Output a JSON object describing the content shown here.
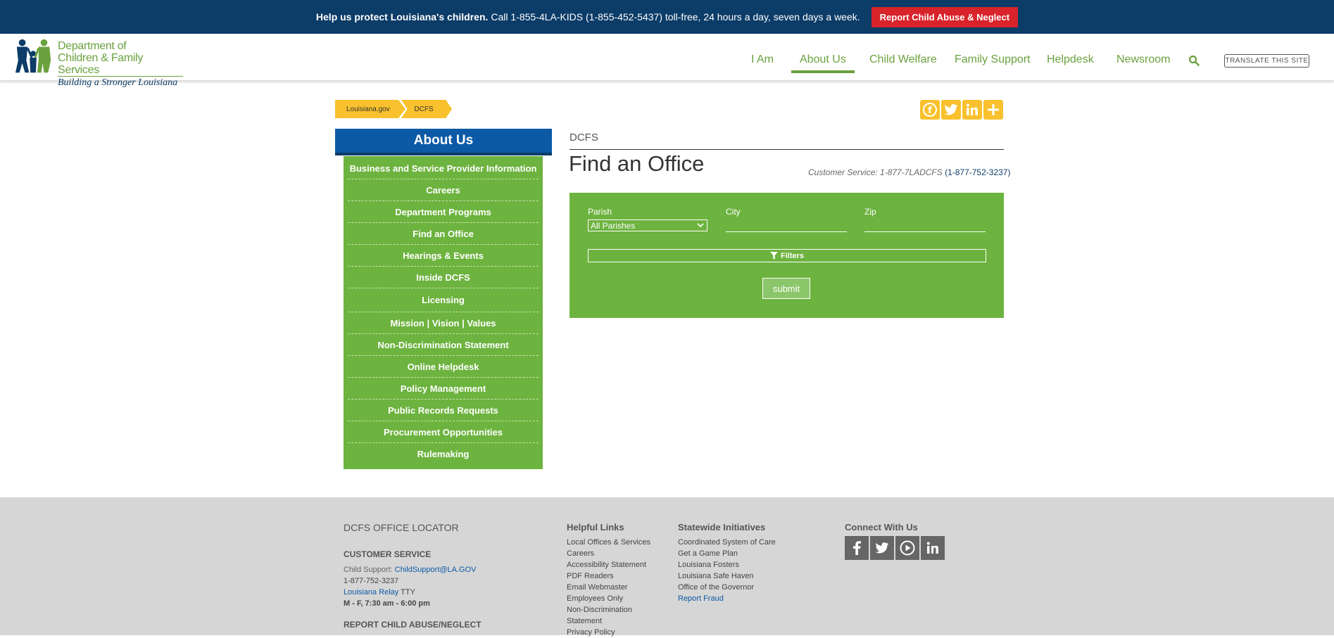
{
  "alert": {
    "bold_text": "Help us protect Louisiana's children.",
    "text": "Call 1-855-4LA-KIDS (1-855-452-5437) toll-free, 24 hours a day, seven days a week.",
    "button_label": "Report Child Abuse & Neglect"
  },
  "logo": {
    "line1": "Department of",
    "line2": "Children & Family Services",
    "tagline": "Building a Stronger Louisiana"
  },
  "nav": {
    "items": [
      {
        "label": "I Am"
      },
      {
        "label": "About Us"
      },
      {
        "label": "Child Welfare"
      },
      {
        "label": "Family Support"
      },
      {
        "label": "Helpdesk"
      },
      {
        "label": "Newsroom"
      }
    ],
    "translate_label": "TRANSLATE THIS SITE",
    "search_icon": "search-icon"
  },
  "breadcrumb": {
    "items": [
      "Louisiana.gov",
      "DCFS"
    ]
  },
  "share": {
    "icons": [
      "facebook-icon",
      "twitter-icon",
      "linkedin-icon",
      "plus-icon"
    ]
  },
  "sidebar": {
    "title": "About Us",
    "items": [
      "Business and Service Provider Information",
      "Careers",
      "Department Programs",
      "Find an Office",
      "Hearings & Events",
      "Inside DCFS",
      "Licensing",
      "Mission | Vision | Values",
      "Non-Discrimination Statement",
      "Online Helpdesk",
      "Policy Management",
      "Public Records Requests",
      "Procurement Opportunities",
      "Rulemaking"
    ]
  },
  "main": {
    "section_label": "DCFS",
    "title": "Find an Office",
    "customer_service": "Customer Service: 1-877-7LADCFS",
    "customer_service_number": "(1-877-752-3237)"
  },
  "finder": {
    "parish_label": "Parish",
    "parish_value": "All Parishes",
    "city_label": "City",
    "zip_label": "Zip",
    "filters_label": "Filters",
    "submit_label": "submit"
  },
  "footer": {
    "locator_title": "DCFS OFFICE LOCATOR",
    "customer_service_heading": "CUSTOMER SERVICE",
    "child_support_label": "Child Support:",
    "child_support_email": "ChildSupport@LA.GOV",
    "phone": "1-877-752-3237",
    "relay_link": "Louisiana Relay",
    "relay_suffix": "TTY",
    "hours": "M - F, 7:30 am - 6:00 pm",
    "report_heading": "REPORT CHILD ABUSE/NEGLECT",
    "helpful_heading": "Helpful Links",
    "helpful_links": [
      "Local Offices & Services",
      "Careers",
      "Accessibility Statement",
      "PDF Readers",
      "Email Webmaster",
      "Employees Only",
      "Non-Discrimination",
      "Statement",
      "Privacy Policy"
    ],
    "statewide_heading": "Statewide Initiatives",
    "statewide_links": [
      "Coordinated System of Care",
      "Get a Game Plan",
      "Louisiana Fosters",
      "Louisiana Safe Haven",
      "Office of the Governor",
      "Report Fraud"
    ],
    "connect_heading": "Connect With Us",
    "social_icons": [
      "facebook-icon",
      "twitter-icon",
      "youtube-icon",
      "linkedin-icon"
    ]
  },
  "colors": {
    "navy": "#0c3c68",
    "green": "#6db33f",
    "red": "#d8232a",
    "yellow": "#f8c12d",
    "blue": "#0c5aa6"
  }
}
